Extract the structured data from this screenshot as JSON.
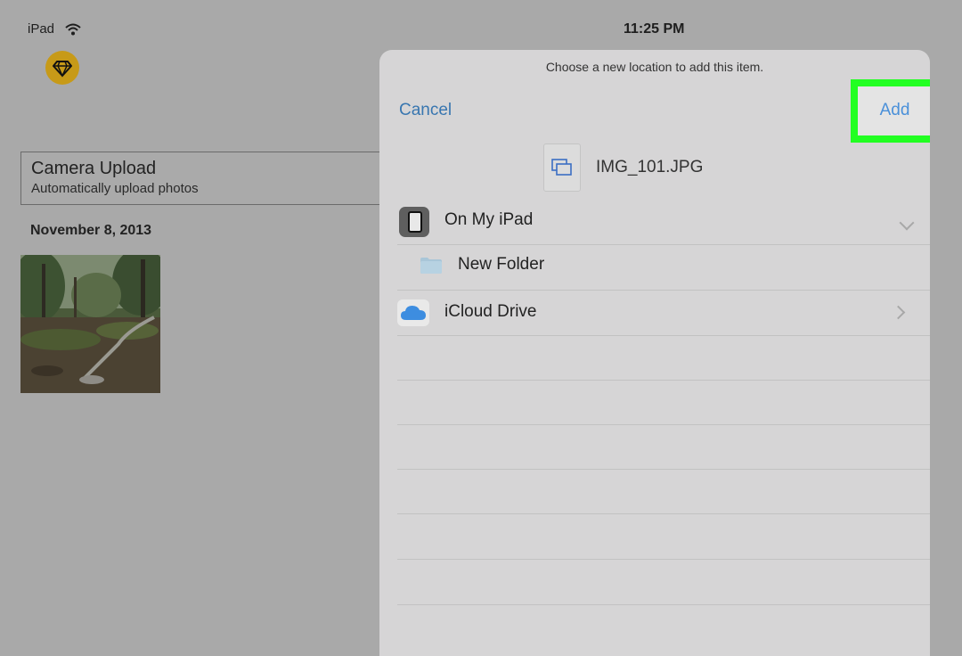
{
  "status": {
    "device": "iPad",
    "time": "11:25 PM"
  },
  "background": {
    "camera_upload": {
      "title": "Camera Upload",
      "subtitle": "Automatically upload photos"
    },
    "date_header": "November 8, 2013"
  },
  "sheet": {
    "prompt": "Choose a new location to add this item.",
    "cancel_label": "Cancel",
    "add_label": "Add",
    "file_name": "IMG_101.JPG",
    "locations": [
      {
        "label": "On My iPad",
        "icon": "ipad-icon",
        "chevron": "chevron-down-icon"
      },
      {
        "label": "New Folder",
        "icon": "folder-icon"
      },
      {
        "label": "iCloud Drive",
        "icon": "icloud-icon",
        "chevron": "chevron-right-icon"
      }
    ]
  },
  "colors": {
    "accent": "#3876b0",
    "add_button": "#4a90d9",
    "highlight": "#22ff22",
    "app_logo": "#c79a18"
  }
}
